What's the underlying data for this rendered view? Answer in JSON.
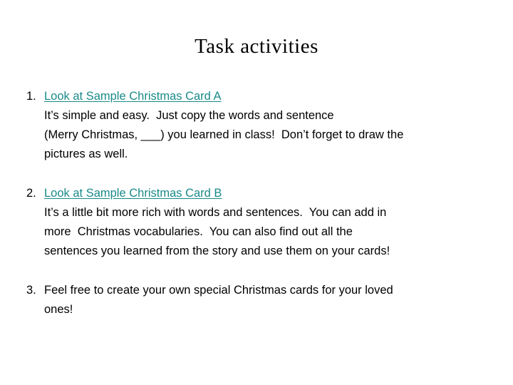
{
  "slide": {
    "title": "Task activities",
    "background_color": "#ffffff",
    "text_color": "#000000",
    "link_color": "#1a8a8a"
  },
  "items": [
    {
      "number": "1.",
      "heading": "Look at Sample Christmas Card A",
      "heading_is_link": true,
      "lines": [
        "It’s simple and easy.  Just copy the words and sentence",
        "(Merry Christmas, ___) you learned in class!  Don’t forget to draw the",
        "pictures as well."
      ]
    },
    {
      "number": "2.",
      "heading": "Look at Sample Christmas Card B",
      "heading_is_link": true,
      "lines": [
        "It’s a little bit more rich with words and sentences.  You can add in",
        "more  Christmas vocabularies.  You can also find out all the",
        "sentences you learned from the story and use them on your cards!"
      ]
    },
    {
      "number": "3.",
      "heading": "Feel free to create your own special Christmas cards for your loved",
      "heading_is_link": false,
      "lines": [
        "ones!"
      ]
    }
  ]
}
